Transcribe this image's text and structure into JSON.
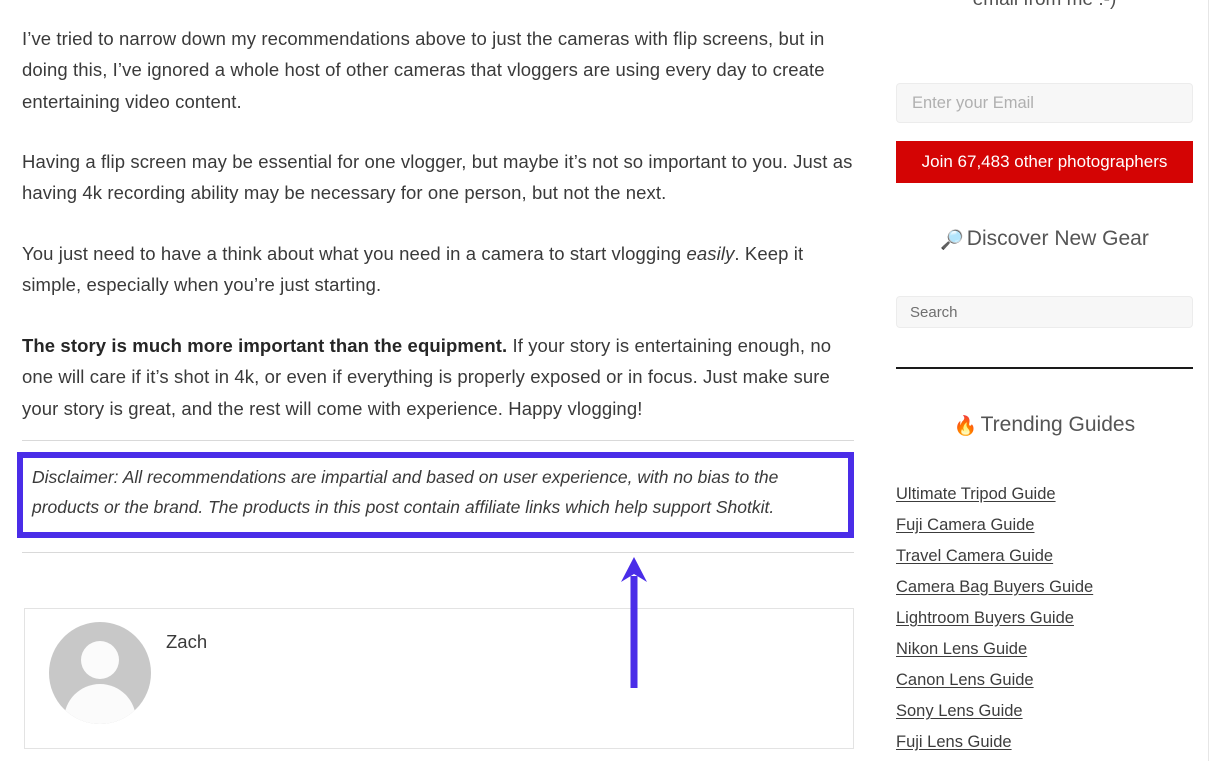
{
  "article": {
    "paragraphs": [
      {
        "id": "p1",
        "text": "I’ve tried to narrow down my recommendations above to just the cameras with flip screens, but in doing this, I’ve ignored a whole host of other cameras that vloggers are using every day to create entertaining video content."
      },
      {
        "id": "p2",
        "text": "Having a flip screen may be essential for one vlogger, but maybe it’s not so important to you. Just as having 4k recording ability may be necessary for one person, but not the next."
      },
      {
        "id": "p3a",
        "text": "You just need to have a think about what you need in a camera to start vlogging "
      },
      {
        "id": "p3b",
        "text": "easily"
      },
      {
        "id": "p3c",
        "text": ". Keep it simple, especially when you’re just starting."
      },
      {
        "id": "p4a",
        "text": "The story is much more important than the equipment."
      },
      {
        "id": "p4b",
        "text": " If your story is entertaining enough, no one will care if it’s shot in 4k, or even if everything is properly exposed or in focus. Just make sure your story is great, and the rest will come with experience. Happy vlogging!"
      }
    ],
    "disclaimer": {
      "text": "Disclaimer: All recommendations are impartial and based on user experience, with no bias to the products or the brand. The products in this post contain affiliate links which help support Shotkit.",
      "border_color": "#4a2de8"
    },
    "author": {
      "name": "Zach",
      "avatar_icon": "person-placeholder-icon"
    },
    "annotation": {
      "icon": "up-arrow-icon",
      "color": "#4a2de8"
    }
  },
  "sidebar": {
    "optin": {
      "text": "email from me :-)",
      "email_placeholder": "Enter your Email",
      "email_value": "",
      "button_label": "Join 67,483 other photographers",
      "button_color": "#d40404"
    },
    "discover": {
      "emoji": "🔎",
      "heading": "Discover New Gear",
      "search_placeholder": "Search",
      "search_value": ""
    },
    "trending": {
      "emoji": "🔥",
      "heading": "Trending Guides",
      "links": [
        "Ultimate Tripod Guide",
        "Fuji Camera Guide",
        "Travel Camera Guide",
        "Camera Bag Buyers Guide",
        "Lightroom Buyers Guide",
        "Nikon Lens Guide",
        "Canon Lens Guide",
        "Sony Lens Guide",
        "Fuji Lens Guide"
      ]
    }
  }
}
